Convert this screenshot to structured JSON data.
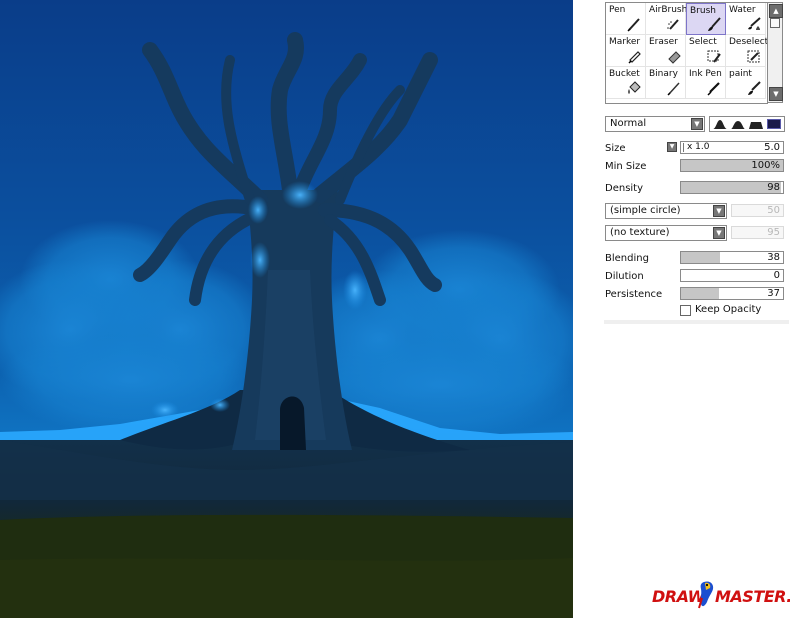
{
  "tools": [
    {
      "label": "Pen",
      "icon": "pen-icon"
    },
    {
      "label": "AirBrush",
      "icon": "airbrush-icon"
    },
    {
      "label": "Brush",
      "icon": "brush-icon",
      "selected": true
    },
    {
      "label": "Water",
      "icon": "water-icon"
    },
    {
      "label": "Marker",
      "icon": "marker-icon"
    },
    {
      "label": "Eraser",
      "icon": "eraser-icon"
    },
    {
      "label": "Select",
      "icon": "select-icon"
    },
    {
      "label": "Deselect",
      "icon": "deselect-icon"
    },
    {
      "label": "Bucket",
      "icon": "bucket-icon"
    },
    {
      "label": "Binary",
      "icon": "binary-icon"
    },
    {
      "label": "Ink Pen",
      "icon": "ink-pen-icon"
    },
    {
      "label": "paint",
      "icon": "paint-icon"
    }
  ],
  "settings": {
    "blend_mode": "Normal",
    "size": {
      "label": "Size",
      "multiplier": "x 1.0",
      "value": "5.0"
    },
    "min_size": {
      "label": "Min Size",
      "value": "100%",
      "level": 100
    },
    "density": {
      "label": "Density",
      "value": "98",
      "level": 98
    },
    "brush_shape": {
      "value": "(simple circle)",
      "amount": "50"
    },
    "texture": {
      "value": "(no texture)",
      "amount": "95"
    },
    "blending": {
      "label": "Blending",
      "value": "38",
      "level": 38
    },
    "dilution": {
      "label": "Dilution",
      "value": "0",
      "level": 0
    },
    "persistence": {
      "label": "Persistence",
      "value": "37",
      "level": 37
    },
    "keep_opacity": {
      "label": "Keep Opacity",
      "checked": false
    }
  },
  "watermark": {
    "part1": "DRAW",
    "part2": "MASTER.RU"
  },
  "colors": {
    "selection": "#dcd7f3",
    "selection_border": "#7d74c9",
    "sky_top": "#0a3f8a",
    "glow": "#1a9ce8",
    "ground": "#1d2a12"
  }
}
